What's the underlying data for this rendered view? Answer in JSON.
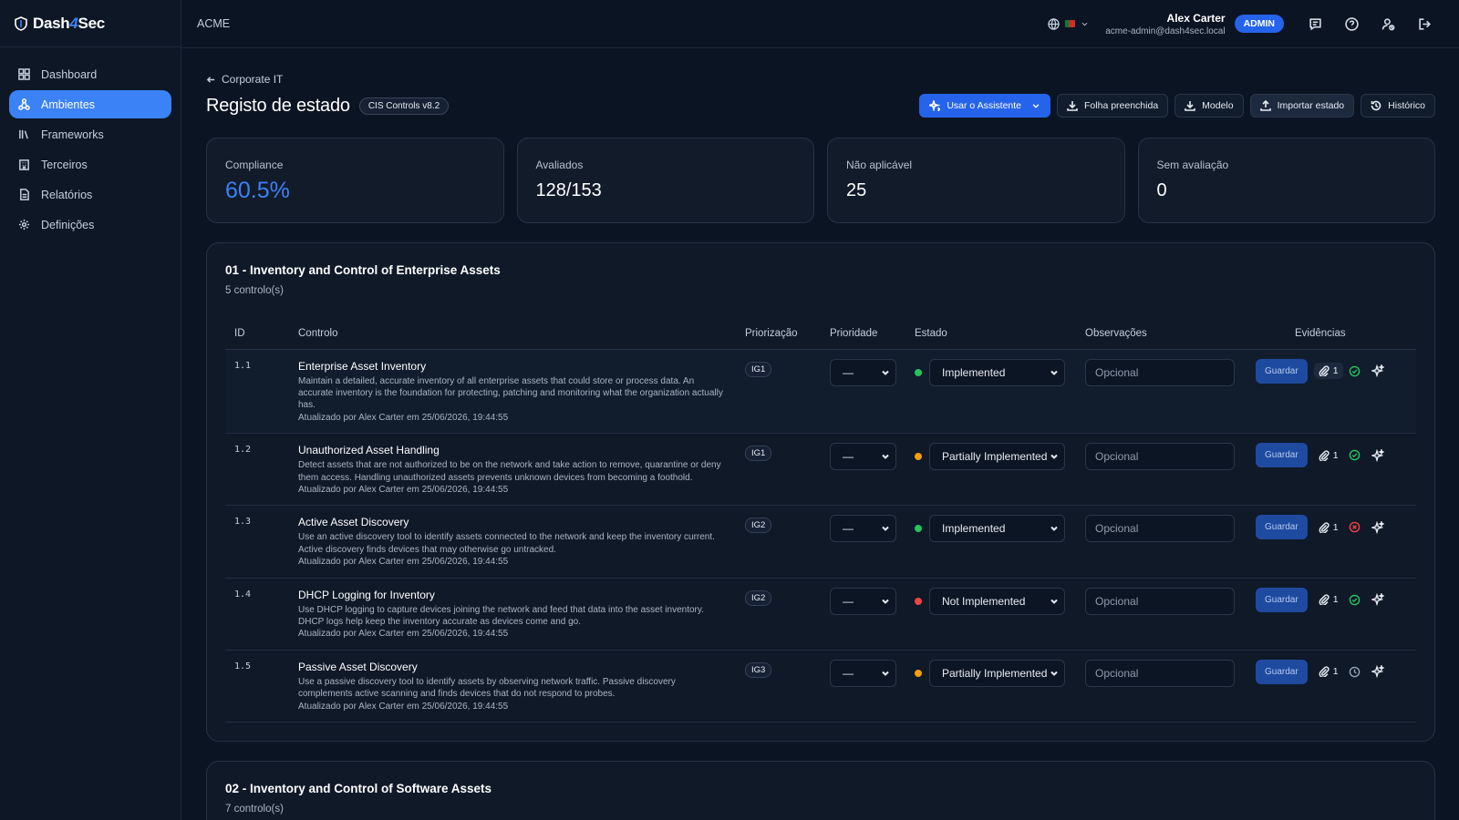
{
  "app": {
    "brand_a": "Dash",
    "brand_b": "4",
    "brand_c": "Sec",
    "tenant": "ACME"
  },
  "sidebar": {
    "items": [
      {
        "label": "Dashboard",
        "icon": "grid-icon"
      },
      {
        "label": "Ambientes",
        "icon": "network-icon",
        "active": true
      },
      {
        "label": "Frameworks",
        "icon": "library-icon"
      },
      {
        "label": "Terceiros",
        "icon": "building-icon"
      },
      {
        "label": "Relatórios",
        "icon": "document-icon"
      },
      {
        "label": "Definições",
        "icon": "gear-icon"
      }
    ]
  },
  "header": {
    "language_icon": "globe-icon",
    "user_name": "Alex Carter",
    "user_email": "acme-admin@dash4sec.local",
    "role": "ADMIN"
  },
  "page": {
    "back_label": "Corporate IT",
    "title": "Registo de estado",
    "framework_badge": "CIS Controls v8.2",
    "actions": {
      "assistant": "Usar o Assistente",
      "filled_sheet": "Folha preenchida",
      "template": "Modelo",
      "import_state": "Importar estado",
      "history": "Histórico"
    }
  },
  "stats": [
    {
      "label": "Compliance",
      "value": "60.5%"
    },
    {
      "label": "Avaliados",
      "value": "128/153"
    },
    {
      "label": "Não aplicável",
      "value": "25"
    },
    {
      "label": "Sem avaliação",
      "value": "0"
    }
  ],
  "columns": {
    "id": "ID",
    "control": "Controlo",
    "prioritization": "Priorização",
    "priority": "Prioridade",
    "status": "Estado",
    "notes": "Observações",
    "evidence": "Evidências"
  },
  "row_common": {
    "priority_value": "—",
    "notes_placeholder": "Opcional",
    "save_label": "Guardar",
    "attach_count": "1"
  },
  "sections": [
    {
      "title": "01 - Inventory and Control of Enterprise Assets",
      "count": "5 controlo(s)",
      "rows": [
        {
          "id": "1.1",
          "title": "Enterprise Asset Inventory",
          "desc": "Maintain a detailed, accurate inventory of all enterprise assets that could store or process data. An accurate inventory is the foundation for protecting, patching and monitoring what the organization actually has.",
          "updated": "Atualizado por Alex Carter em 25/06/2026, 19:44:55",
          "ig": "IG1",
          "status": "Implemented",
          "dot": "#22c55e",
          "verify": "ok"
        },
        {
          "id": "1.2",
          "title": "Unauthorized Asset Handling",
          "desc": "Detect assets that are not authorized to be on the network and take action to remove, quarantine or deny them access. Handling unauthorized assets prevents unknown devices from becoming a foothold.",
          "updated": "Atualizado por Alex Carter em 25/06/2026, 19:44:55",
          "ig": "IG1",
          "status": "Partially Implemented",
          "dot": "#f59e0b",
          "verify": "ok"
        },
        {
          "id": "1.3",
          "title": "Active Asset Discovery",
          "desc": "Use an active discovery tool to identify assets connected to the network and keep the inventory current. Active discovery finds devices that may otherwise go untracked.",
          "updated": "Atualizado por Alex Carter em 25/06/2026, 19:44:55",
          "ig": "IG2",
          "status": "Implemented",
          "dot": "#22c55e",
          "verify": "fail"
        },
        {
          "id": "1.4",
          "title": "DHCP Logging for Inventory",
          "desc": "Use DHCP logging to capture devices joining the network and feed that data into the asset inventory. DHCP logs help keep the inventory accurate as devices come and go.",
          "updated": "Atualizado por Alex Carter em 25/06/2026, 19:44:55",
          "ig": "IG2",
          "status": "Not Implemented",
          "dot": "#ef4444",
          "verify": "ok"
        },
        {
          "id": "1.5",
          "title": "Passive Asset Discovery",
          "desc": "Use a passive discovery tool to identify assets by observing network traffic. Passive discovery complements active scanning and finds devices that do not respond to probes.",
          "updated": "Atualizado por Alex Carter em 25/06/2026, 19:44:55",
          "ig": "IG3",
          "status": "Partially Implemented",
          "dot": "#f59e0b",
          "verify": "pending"
        }
      ]
    },
    {
      "title": "02 - Inventory and Control of Software Assets",
      "count": "7 controlo(s)"
    }
  ],
  "colors": {
    "accent": "#3b82f6",
    "ok": "#22c55e",
    "fail": "#ef4444",
    "pending": "#94a3b8"
  }
}
